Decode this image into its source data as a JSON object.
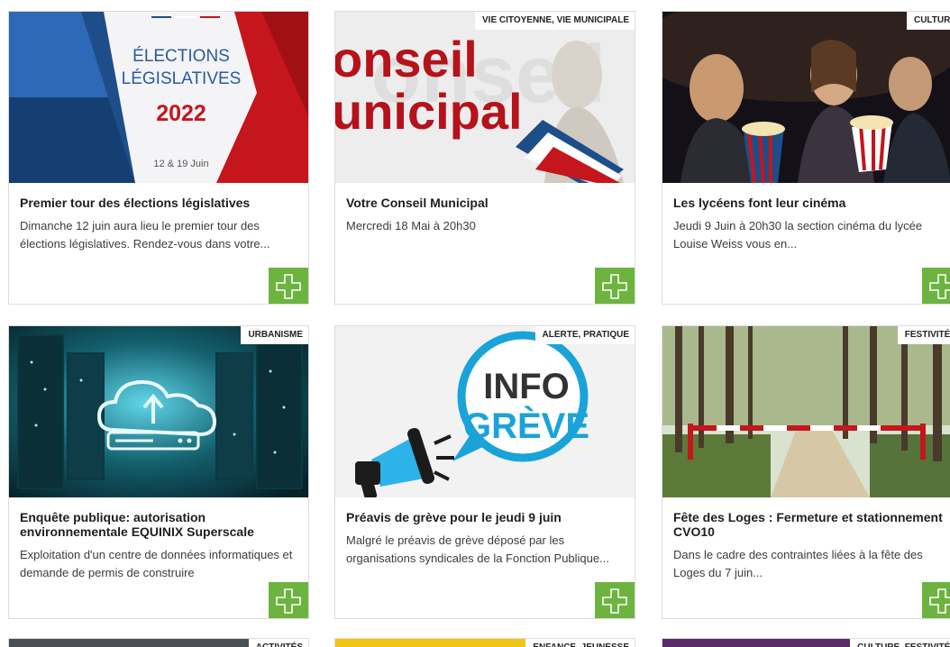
{
  "cards": [
    {
      "tag": "",
      "image_text": {
        "line1": "ÉLECTIONS",
        "line2": "LÉGISLATIVES",
        "year": "2022",
        "dates": "12 & 19 Juin"
      },
      "title": "Premier tour des élections législatives",
      "excerpt": "Dimanche 12 juin aura lieu le premier tour des élections législatives. Rendez-vous dans votre..."
    },
    {
      "tag": "VIE CITOYENNE, VIE MUNICIPALE",
      "image_text": {
        "line1": "onseil",
        "line2": "unicipal"
      },
      "title": "Votre Conseil Municipal",
      "excerpt": "Mercredi 18 Mai à 20h30"
    },
    {
      "tag": "CULTURE",
      "title": "Les lycéens font leur cinéma",
      "excerpt": "Jeudi 9 Juin à 20h30 la section cinéma du lycée Louise Weiss vous en..."
    },
    {
      "tag": "URBANISME",
      "title": "Enquête publique: autorisation environnementale EQUINIX Superscale",
      "excerpt": "Exploitation d'un centre de données informatiques et demande de permis de construire"
    },
    {
      "tag": "ALERTE, PRATIQUE",
      "image_text": {
        "line1": "INFO",
        "line2": "GRÈVE"
      },
      "title": "Préavis de grève pour le jeudi 9 juin",
      "excerpt": "Malgré le préavis de grève déposé par les organisations syndicales de la Fonction Publique..."
    },
    {
      "tag": "FESTIVITÉS",
      "title": "Fête des Loges : Fermeture et stationnement CVO10",
      "excerpt": "Dans le cadre des contraintes liées à la fête des Loges du 7 juin..."
    },
    {
      "tag": "ACTIVITÉS"
    },
    {
      "tag": "ENFANCE, JEUNESSE"
    },
    {
      "tag": "CULTURE, FESTIVITÉS"
    }
  ],
  "colors": {
    "accent_green": "#6db33f",
    "election_red": "#c4161c",
    "election_blue": "#1d4e89",
    "strike_blue": "#1aa3d9"
  }
}
